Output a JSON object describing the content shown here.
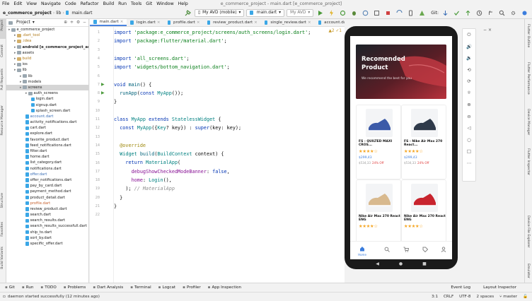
{
  "window_title": "e_commerce_project - main.dart [e_commerce_project]",
  "menu": [
    "File",
    "Edit",
    "View",
    "Navigate",
    "Code",
    "Refactor",
    "Build",
    "Run",
    "Tools",
    "Git",
    "Window",
    "Help"
  ],
  "toolbar": {
    "breadcrumb": [
      "e_commerce_project",
      "lib",
      "main.dart"
    ],
    "device": "My AVD (mobile)",
    "config": "main.dart",
    "avd": "My AVD",
    "git_label": "Git:"
  },
  "project_panel": {
    "title": "Project",
    "tree": [
      {
        "label": "e_commerce_project",
        "indent": 0,
        "kind": "folder",
        "sel": false
      },
      {
        "label": ".dart_tool",
        "indent": 1,
        "kind": "folder-y",
        "sel": false
      },
      {
        "label": ".idea",
        "indent": 1,
        "kind": "folder-y",
        "sel": false
      },
      {
        "label": "android [e_commerce_project_android]",
        "indent": 1,
        "kind": "folder",
        "sel": false,
        "bold": true
      },
      {
        "label": "assets",
        "indent": 1,
        "kind": "folder",
        "sel": false
      },
      {
        "label": "build",
        "indent": 1,
        "kind": "folder-y",
        "sel": false
      },
      {
        "label": "ios",
        "indent": 1,
        "kind": "folder",
        "sel": false
      },
      {
        "label": "lib",
        "indent": 1,
        "kind": "folder",
        "sel": false
      },
      {
        "label": "lib",
        "indent": 2,
        "kind": "folder",
        "sel": false
      },
      {
        "label": "models",
        "indent": 2,
        "kind": "folder",
        "sel": false
      },
      {
        "label": "screens",
        "indent": 2,
        "kind": "folder",
        "sel": true
      },
      {
        "label": "auth_screens",
        "indent": 3,
        "kind": "folder",
        "sel": false
      },
      {
        "label": "login.dart",
        "indent": 4,
        "kind": "file",
        "sel": false
      },
      {
        "label": "signup.dart",
        "indent": 4,
        "kind": "file",
        "sel": false
      },
      {
        "label": "splash_screen.dart",
        "indent": 4,
        "kind": "file",
        "sel": false
      },
      {
        "label": "account.dart",
        "indent": 3,
        "kind": "file",
        "sel": false,
        "color": "#3b6fb6"
      },
      {
        "label": "activity_notifications.dart",
        "indent": 3,
        "kind": "file",
        "sel": false
      },
      {
        "label": "cart.dart",
        "indent": 3,
        "kind": "file",
        "sel": false
      },
      {
        "label": "explore.dart",
        "indent": 3,
        "kind": "file",
        "sel": false
      },
      {
        "label": "favorite_product.dart",
        "indent": 3,
        "kind": "file",
        "sel": false
      },
      {
        "label": "feed_notifications.dart",
        "indent": 3,
        "kind": "file",
        "sel": false
      },
      {
        "label": "filter.dart",
        "indent": 3,
        "kind": "file",
        "sel": false
      },
      {
        "label": "home.dart",
        "indent": 3,
        "kind": "file",
        "sel": false
      },
      {
        "label": "list_category.dart",
        "indent": 3,
        "kind": "file",
        "sel": false
      },
      {
        "label": "notifications.dart",
        "indent": 3,
        "kind": "file",
        "sel": false
      },
      {
        "label": "offer.dart",
        "indent": 3,
        "kind": "file",
        "sel": false,
        "color": "#3b6fb6"
      },
      {
        "label": "offer_notifications.dart",
        "indent": 3,
        "kind": "file",
        "sel": false
      },
      {
        "label": "pay_by_card.dart",
        "indent": 3,
        "kind": "file",
        "sel": false
      },
      {
        "label": "payment_method.dart",
        "indent": 3,
        "kind": "file",
        "sel": false
      },
      {
        "label": "product_detail.dart",
        "indent": 3,
        "kind": "file",
        "sel": false
      },
      {
        "label": "profile.dart",
        "indent": 3,
        "kind": "file",
        "sel": false,
        "color": "#c7622f"
      },
      {
        "label": "review_product.dart",
        "indent": 3,
        "kind": "file",
        "sel": false
      },
      {
        "label": "search.dart",
        "indent": 3,
        "kind": "file",
        "sel": false
      },
      {
        "label": "search_results.dart",
        "indent": 3,
        "kind": "file",
        "sel": false
      },
      {
        "label": "search_results_successfull.dart",
        "indent": 3,
        "kind": "file",
        "sel": false
      },
      {
        "label": "ship_to.dart",
        "indent": 3,
        "kind": "file",
        "sel": false
      },
      {
        "label": "sort_by.dart",
        "indent": 3,
        "kind": "file",
        "sel": false
      },
      {
        "label": "specific_offer.dart",
        "indent": 3,
        "kind": "file",
        "sel": false
      }
    ]
  },
  "left_strip": [
    "Project",
    "Commit",
    "Pull Requests",
    "Resource Manager",
    "Structure",
    "Favorites",
    "Build Variants"
  ],
  "right_strip": [
    "Flutter Outline",
    "Flutter Performance",
    "Device Manager",
    "Flutter Inspector",
    "Device File Explorer",
    "Emulator"
  ],
  "editor": {
    "tabs": [
      {
        "label": "main.dart",
        "active": true
      },
      {
        "label": "login.dart",
        "active": false
      },
      {
        "label": "profile.dart",
        "active": false
      },
      {
        "label": "review_product.dart",
        "active": false
      },
      {
        "label": "single_review.dart",
        "active": false
      },
      {
        "label": "account.dart",
        "active": false
      }
    ],
    "line_numbers": [
      "1",
      "2",
      "3",
      "4",
      "5",
      "6",
      "7",
      "8",
      "9",
      "10",
      "11",
      "12",
      "13",
      "14",
      "15",
      "16",
      "17",
      "18",
      "19",
      "20",
      "21",
      "22"
    ],
    "inspection": "▲2  ✓1"
  },
  "emulator": {
    "banner_title_1": "Recomended",
    "banner_title_2": "Product",
    "banner_sub": "We recommend the best for you",
    "products": [
      {
        "name": "FS - QUILTED MAXI CROS...",
        "stars": "★★★★☆",
        "price": "$299,43",
        "old": "$534,33",
        "disc": "24% Off",
        "img": "#3c5aa8"
      },
      {
        "name": "FS - Nike Air Max 270 React...",
        "stars": "★★★★☆",
        "price": "$299,43",
        "old": "$534,33",
        "disc": "24% Off",
        "img": "#2f3a4a"
      },
      {
        "name": "Nike Air Max 270 React ENG",
        "stars": "★★★★☆",
        "price": "",
        "old": "",
        "disc": "",
        "img": "#d8b98e"
      },
      {
        "name": "Nike Air Max 270 React ENG",
        "stars": "★★★★☆",
        "price": "",
        "old": "",
        "disc": "",
        "img": "#c8242e"
      }
    ],
    "nav": [
      {
        "label": "Home",
        "icon": "home-icon",
        "active": true
      },
      {
        "label": "",
        "icon": "search-icon",
        "active": false
      },
      {
        "label": "",
        "icon": "cart-icon",
        "active": false
      },
      {
        "label": "",
        "icon": "offer-icon",
        "active": false
      },
      {
        "label": "",
        "icon": "account-icon",
        "active": false
      }
    ],
    "side_buttons": [
      "power-icon",
      "volume-up-icon",
      "volume-down-icon",
      "rotate-left-icon",
      "rotate-right-icon",
      "camera-icon",
      "zoom-in-icon",
      "zoom-out-icon",
      "back-icon",
      "home-circle-icon",
      "overview-icon",
      "more-icon"
    ]
  },
  "tool_windows": [
    "Git",
    "Run",
    "TODO",
    "Problems",
    "Dart Analysis",
    "Terminal",
    "Logcat",
    "Profiler",
    "App Inspection"
  ],
  "tool_windows_right": [
    "Event Log",
    "Layout Inspector"
  ],
  "status": {
    "message": "daemon started successfully (12 minutes ago)",
    "position": "3:1",
    "line_sep": "CRLF",
    "encoding": "UTF-8",
    "indent": "2 spaces",
    "branch": "master"
  }
}
